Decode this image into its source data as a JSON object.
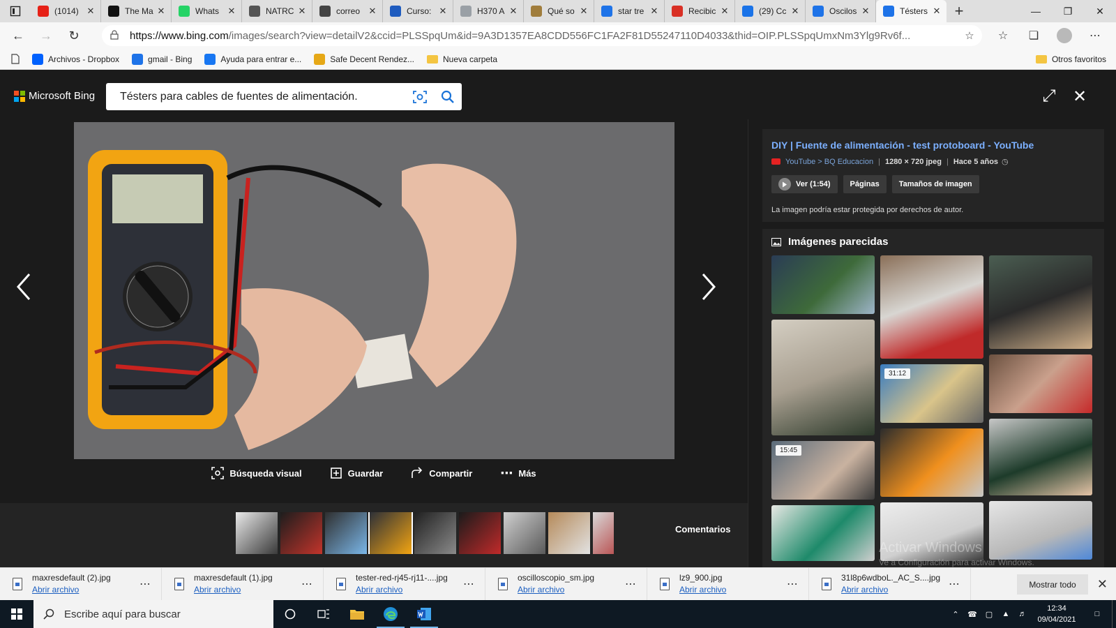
{
  "tabs": [
    {
      "label": "(1014)",
      "icon": "youtube-icon",
      "color": "#e62117",
      "active": false
    },
    {
      "label": "The Ma",
      "icon": "medium-icon",
      "color": "#111111",
      "active": false
    },
    {
      "label": "Whats",
      "icon": "whatsapp-icon",
      "color": "#25d366",
      "active": false
    },
    {
      "label": "NATRC",
      "icon": "globe-icon",
      "color": "#555555",
      "active": false
    },
    {
      "label": "correo",
      "icon": "page-icon",
      "color": "#444444",
      "active": false
    },
    {
      "label": "Curso:",
      "icon": "education-cap-icon",
      "color": "#1f5cbf",
      "active": false
    },
    {
      "label": "H370 A",
      "icon": "grammar-g-icon",
      "color": "#9aa0a6",
      "active": false
    },
    {
      "label": "Qué so",
      "icon": "medium-icon",
      "color": "#a07d3c",
      "active": false
    },
    {
      "label": "star tre",
      "icon": "bing-icon",
      "color": "#1e73e8",
      "active": false
    },
    {
      "label": "Recibic",
      "icon": "gmail-icon",
      "color": "#d93025",
      "active": false
    },
    {
      "label": "(29) Cc",
      "icon": "mail-icon",
      "color": "#1a73e8",
      "active": false
    },
    {
      "label": "Oscilos",
      "icon": "bing-icon",
      "color": "#1e73e8",
      "active": false
    },
    {
      "label": "Tésters",
      "icon": "bing-icon",
      "color": "#1e73e8",
      "active": true
    }
  ],
  "address": {
    "url_domain": "https://www.bing.com",
    "url_rest": "/images/search?view=detailV2&ccid=PLSSpqUm&id=9A3D1357EA8CDD556FC1FA2F81D55247110D4033&thid=OIP.PLSSpqUmxNm3Ylg9Rv6f..."
  },
  "bookmarks": [
    {
      "label": "Archivos - Dropbox",
      "icon": "dropbox-icon",
      "color": "#0061fe"
    },
    {
      "label": "gmail - Bing",
      "icon": "bing-icon",
      "color": "#1e73e8"
    },
    {
      "label": "Ayuda para entrar e...",
      "icon": "facebook-icon",
      "color": "#1877f2"
    },
    {
      "label": "Safe Decent Rendez...",
      "icon": "star-person-icon",
      "color": "#e6a817"
    },
    {
      "label": "Nueva carpeta",
      "icon": "folder-icon",
      "color": "#f4c542"
    }
  ],
  "bookmarks_right": "Otros favoritos",
  "bing": {
    "logo_text": "Microsoft Bing",
    "query": "Tésters para cables de fuentes de alimentación.",
    "actions": [
      {
        "label": "Búsqueda visual",
        "icon": "visual-search-icon"
      },
      {
        "label": "Guardar",
        "icon": "save-icon"
      },
      {
        "label": "Compartir",
        "icon": "share-icon"
      },
      {
        "label": "Más",
        "icon": "more-icon"
      }
    ],
    "feedback": "Comentarios",
    "filmstrip_count": 9,
    "filmstrip_selected": 3
  },
  "details": {
    "title": "DIY | Fuente de alimentación - test protoboard - YouTube",
    "source": "YouTube > BQ Educacion",
    "dims": "1280 × 720 jpeg",
    "age": "Hace 5 años",
    "buttons": [
      "Ver (1:54)",
      "Páginas",
      "Tamaños de imagen"
    ],
    "copyright": "La imagen podría estar protegida por derechos de autor."
  },
  "similar": {
    "title": "Imágenes parecidas",
    "durations": [
      "31:12",
      "15:45"
    ]
  },
  "watermark": {
    "line1": "Activar Windows",
    "line2": "Ve a Configuración para activar Windows."
  },
  "downloads": [
    {
      "name": "maxresdefault (2).jpg",
      "action": "Abrir archivo"
    },
    {
      "name": "maxresdefault (1).jpg",
      "action": "Abrir archivo"
    },
    {
      "name": "tester-red-rj45-rj11-....jpg",
      "action": "Abrir archivo"
    },
    {
      "name": "oscilloscopio_sm.jpg",
      "action": "Abrir archivo"
    },
    {
      "name": "lz9_900.jpg",
      "action": "Abrir archivo"
    },
    {
      "name": "31l8p6wdboL._AC_S....jpg",
      "action": "Abrir archivo"
    }
  ],
  "downloads_show_all": "Mostrar todo",
  "taskbar": {
    "search_placeholder": "Escribe aquí para buscar",
    "time": "12:34",
    "date": "09/04/2021"
  }
}
